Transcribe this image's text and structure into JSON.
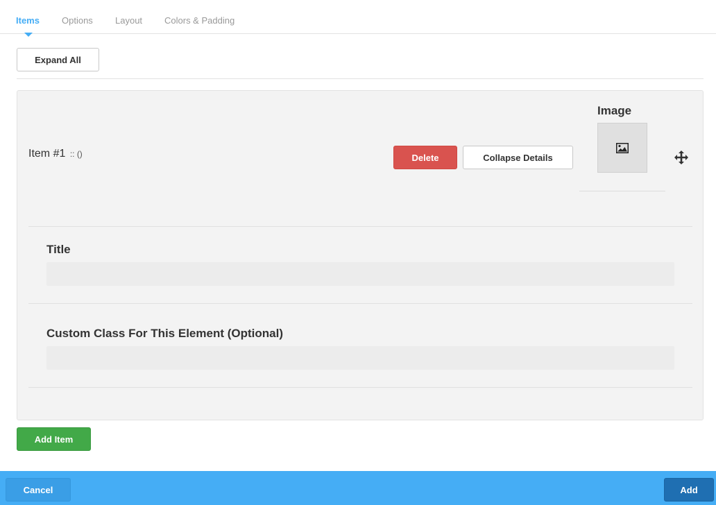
{
  "tabs": [
    {
      "label": "Items",
      "active": true
    },
    {
      "label": "Options",
      "active": false
    },
    {
      "label": "Layout",
      "active": false
    },
    {
      "label": "Colors & Padding",
      "active": false
    }
  ],
  "toolbar": {
    "expand_all_label": "Expand All"
  },
  "item": {
    "title": "Item #1",
    "meta": ":: ()",
    "delete_label": "Delete",
    "collapse_label": "Collapse Details",
    "image_label": "Image",
    "image_icon": "image-icon",
    "move_icon": "move-icon"
  },
  "fields": {
    "title": {
      "label": "Title",
      "value": ""
    },
    "custom_class": {
      "label": "Custom Class For This Element (Optional)",
      "value": ""
    }
  },
  "add_item_label": "Add Item",
  "footer": {
    "cancel_label": "Cancel",
    "add_label": "Add"
  },
  "colors": {
    "accent": "#45ADF5",
    "delete": "#D9534F",
    "add_item": "#42A948",
    "add_button": "#1F6FB2"
  }
}
